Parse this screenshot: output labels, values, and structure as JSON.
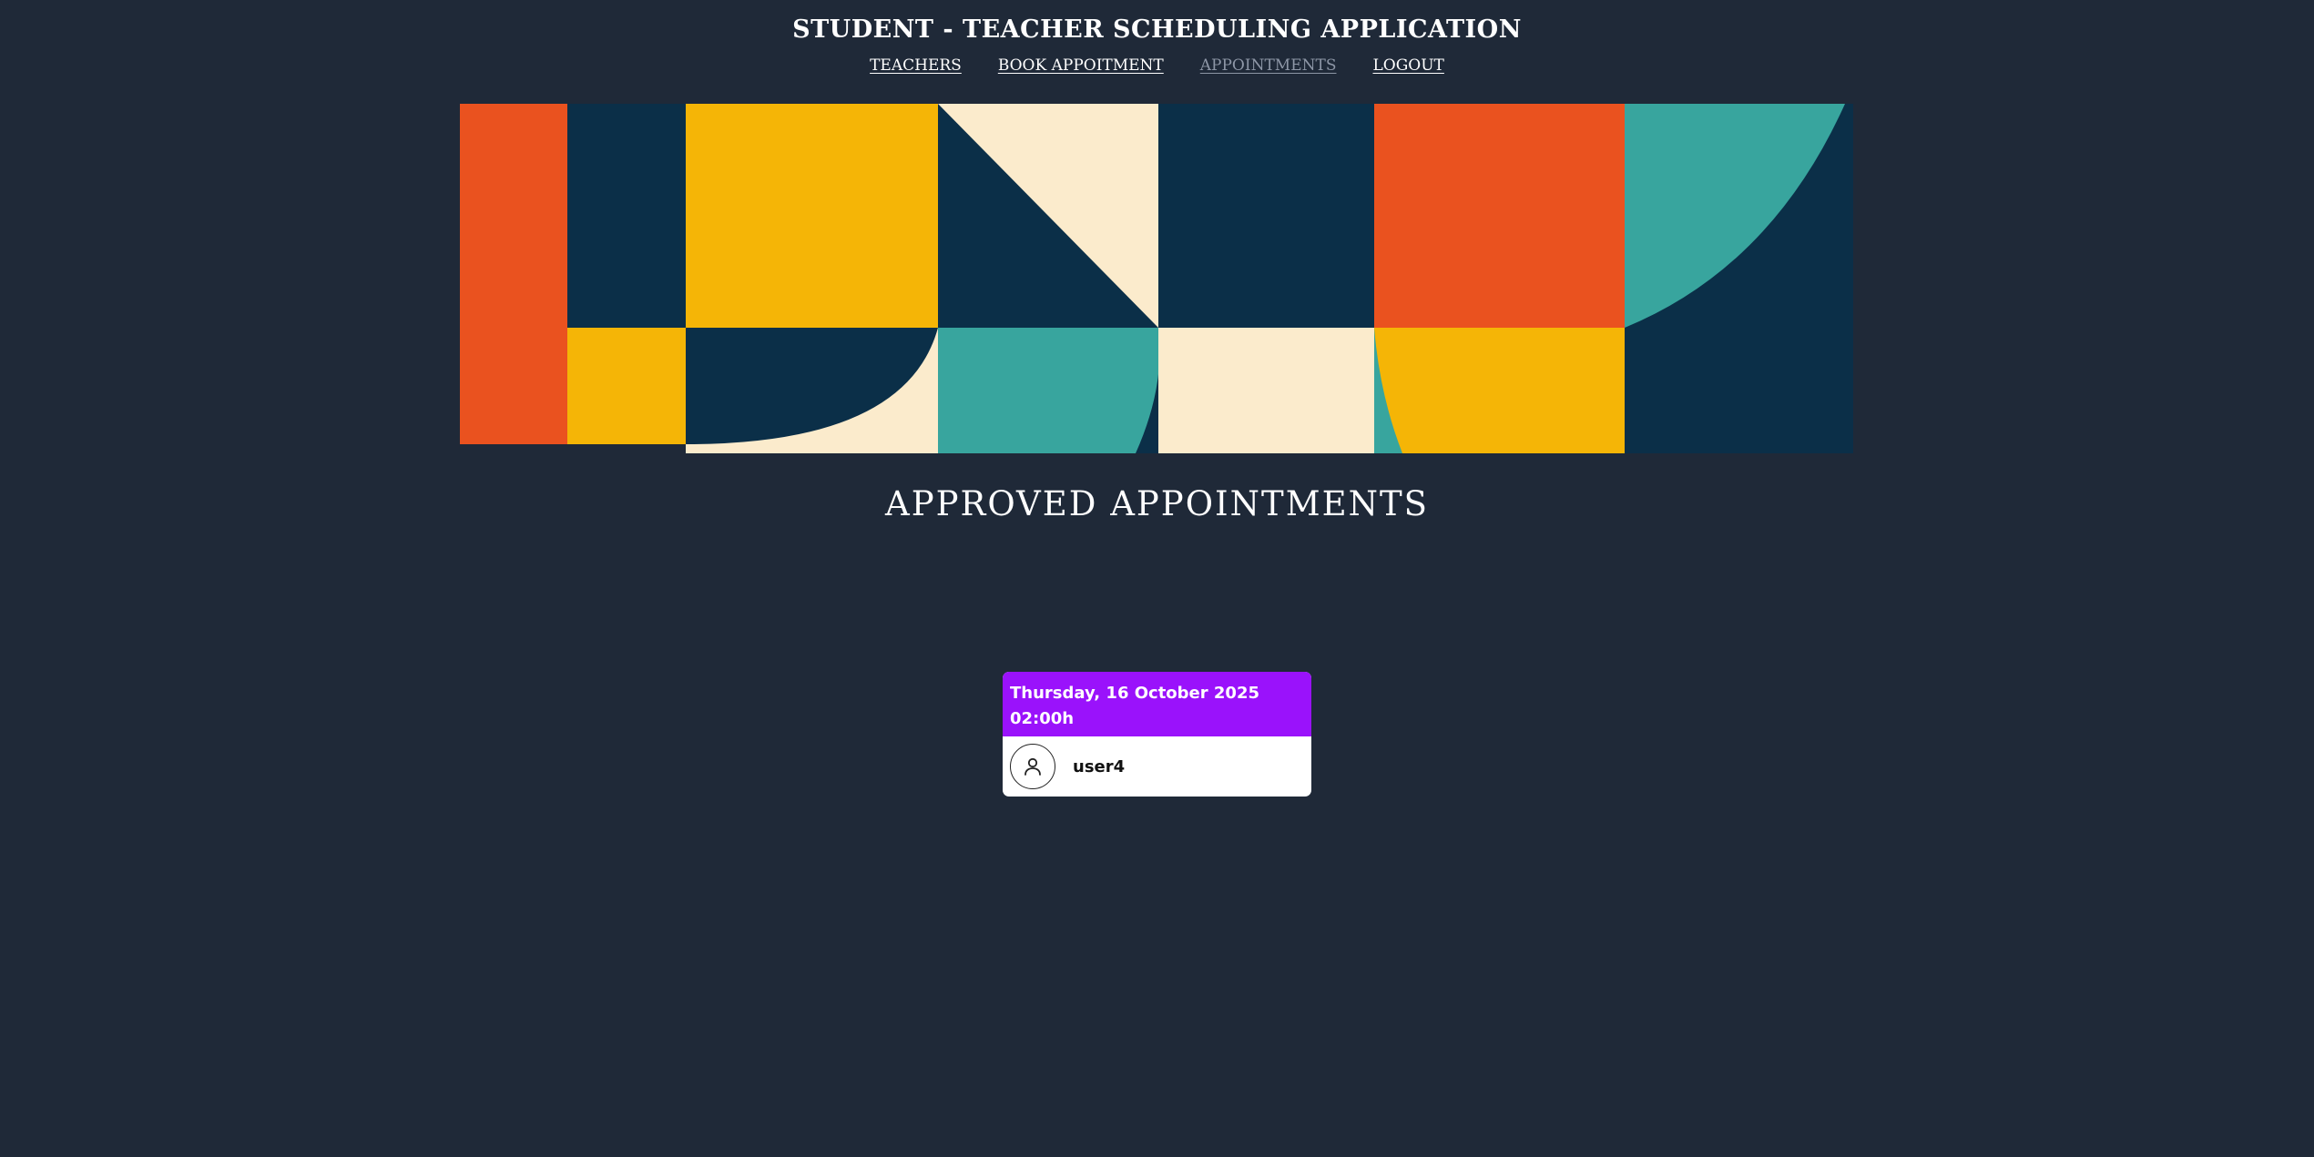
{
  "app": {
    "title": "STUDENT - TEACHER SCHEDULING APPLICATION"
  },
  "nav": {
    "items": [
      {
        "label": "TEACHERS",
        "active": false
      },
      {
        "label": "BOOK APPOITMENT",
        "active": false
      },
      {
        "label": "APPOINTMENTS",
        "active": true
      },
      {
        "label": "LOGOUT",
        "active": false
      }
    ]
  },
  "page": {
    "heading": "APPROVED APPOINTMENTS"
  },
  "appointments": [
    {
      "date": "Thursday, 16 October 2025",
      "time": "02:00h",
      "user": "user4"
    }
  ],
  "colors": {
    "background": "#1f2938",
    "card_header": "#9a12fb",
    "nav_active": "#8d96a6",
    "banner_orange": "#ea521f",
    "banner_navy": "#0b2f48",
    "banner_yellow": "#f5b506",
    "banner_cream": "#fbebcc",
    "banner_teal": "#38a59e"
  },
  "icons": {
    "avatar": "user-outline-icon"
  }
}
